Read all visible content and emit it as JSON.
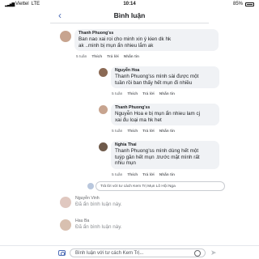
{
  "status": {
    "carrier": "Viettel",
    "network": "LTE",
    "time": "10:14",
    "battery": "85%"
  },
  "header": {
    "back_glyph": "‹",
    "title": "Bình luận"
  },
  "actions": {
    "like": "Thích",
    "reply": "Trả lời",
    "message": "Nhắn tin"
  },
  "comments": [
    {
      "author": "Thanh Phuong'ss",
      "lines": [
        "Ban nao xai roi cho minh xin ý kien dk hk",
        "ak ..minh bị mụn ẩn nhieu lắm ak"
      ],
      "time": "5 tuần"
    },
    {
      "author": "Nguyễn Hoa",
      "lines": [
        "Thanh Phuong'ss mình sài được  một",
        "tuần rồi ban thấy  hết mụn đi  nhiều"
      ],
      "time": "5 tuần"
    },
    {
      "author": "Thanh Phuong'ss",
      "lines": [
        "Nguyễn Hoa e bị mụn ẩn nhieu lam cj",
        "xai đu loại ma hk het"
      ],
      "time": "5 tuần"
    },
    {
      "author": "Nghia Thai",
      "lines": [
        "Thanh Phuong'ss mình dùng hết một",
        "tuýp gần hết mụn .trước mặt mình rất",
        "nhiu mụn"
      ],
      "time": "5 tuần"
    }
  ],
  "reply_box": {
    "placeholder": "Trả lời với tư cách Kem Trị Mụn Lô Hội Nga"
  },
  "hidden_comments": [
    {
      "author": "Nguyễn Vinh",
      "text": "Đã ẩn bình luận này."
    },
    {
      "author": "Hau Ba",
      "text": "Đã ẩn bình luận này."
    }
  ],
  "bottom": {
    "input_placeholder": "Bình luận với tư cách Kem Trị...",
    "send_glyph": "➤"
  },
  "colors": {
    "accent": "#4b6ab5",
    "bubble": "#f0f2f5",
    "muted": "#65676b"
  }
}
